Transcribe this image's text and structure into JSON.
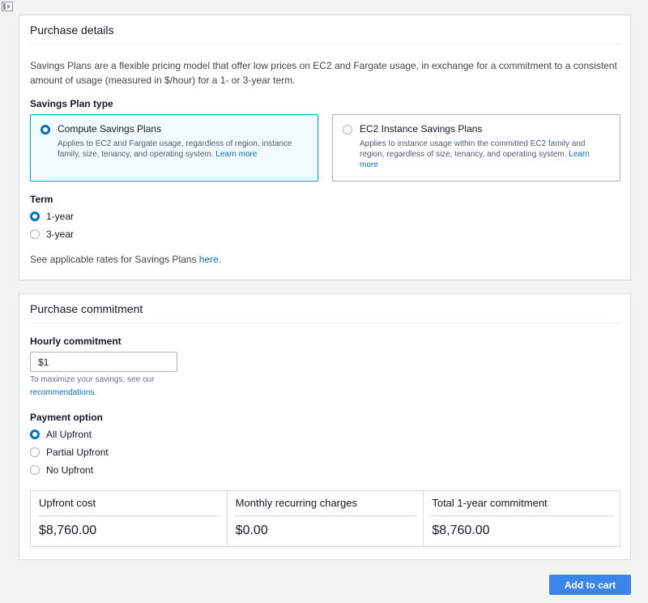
{
  "purchase_details": {
    "title": "Purchase details",
    "description": "Savings Plans are a flexible pricing model that offer low prices on EC2 and Fargate usage, in exchange for a commitment to a consistent amount of usage (measured in $/hour) for a 1- or 3-year term.",
    "plan_type_label": "Savings Plan type",
    "plan_types": [
      {
        "title": "Compute Savings Plans",
        "description": "Applies to EC2 and Fargate usage, regardless of region, instance family, size, tenancy, and operating system.",
        "link": "Learn more",
        "selected": true
      },
      {
        "title": "EC2 Instance Savings Plans",
        "description": "Applies to instance usage within the committed EC2 family and region, regardless of size, tenancy, and operating system.",
        "link": "Learn more",
        "selected": false
      }
    ],
    "term_label": "Term",
    "terms": [
      {
        "label": "1-year",
        "selected": true
      },
      {
        "label": "3-year",
        "selected": false
      }
    ],
    "rates_text": "See applicable rates for Savings Plans ",
    "rates_link": "here",
    "rates_suffix": "."
  },
  "purchase_commitment": {
    "title": "Purchase commitment",
    "hourly_label": "Hourly commitment",
    "hourly_value": "$1",
    "hint_text": "To maximize your savings, see our",
    "hint_link": "recommendations",
    "hint_suffix": ".",
    "payment_label": "Payment option",
    "payment_options": [
      {
        "label": "All Upfront",
        "selected": true
      },
      {
        "label": "Partial Upfront",
        "selected": false
      },
      {
        "label": "No Upfront",
        "selected": false
      }
    ],
    "summary": [
      {
        "label": "Upfront cost",
        "value": "$8,760.00"
      },
      {
        "label": "Monthly recurring charges",
        "value": "$0.00"
      },
      {
        "label": "Total 1-year commitment",
        "value": "$8,760.00"
      }
    ]
  },
  "add_to_cart_label": "Add to cart",
  "colors": {
    "accent": "#0073bb",
    "selected_card_bg": "#f1faff",
    "button": "#3b85e8"
  },
  "icons": {
    "corner": "panel-toggle-icon"
  }
}
